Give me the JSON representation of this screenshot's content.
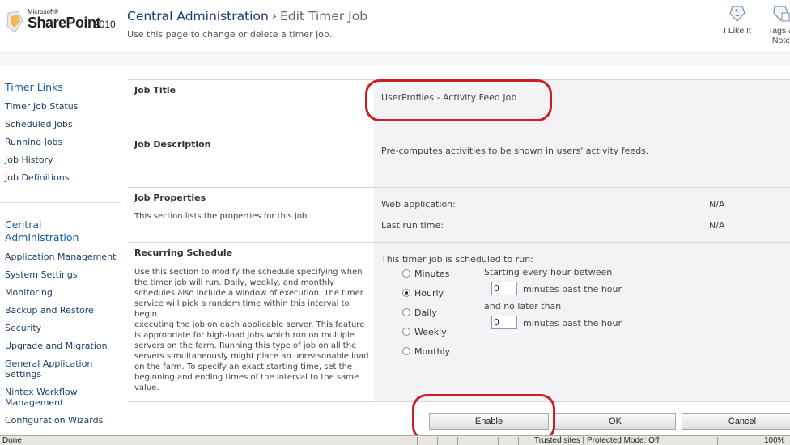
{
  "header": {
    "logo_microsoft": "Microsoft®",
    "logo_product": "SharePoint",
    "logo_year": "2010",
    "title_site": "Central Administration",
    "title_separator": "›",
    "title_page": "Edit Timer Job",
    "subtitle": "Use this page to change or delete a timer job.",
    "actions": {
      "like_label": "I Like It",
      "tags_label": "Tags &",
      "tags_label2": "Note"
    }
  },
  "leftnav": {
    "group1_title": "Timer Links",
    "group1_items": [
      "Timer Job Status",
      "Scheduled Jobs",
      "Running Jobs",
      "Job History",
      "Job Definitions"
    ],
    "group2_title_line1": "Central",
    "group2_title_line2": "Administration",
    "group2_items": [
      "Application Management",
      "System Settings",
      "Monitoring",
      "Backup and Restore",
      "Security",
      "Upgrade and Migration"
    ],
    "general_app_line1": "General Application",
    "general_app_line2": "Settings",
    "nintex_line1": "Nintex Workflow",
    "nintex_line2": "Management",
    "config_wizards": "Configuration Wizards"
  },
  "form": {
    "job_title": {
      "label": "Job Title",
      "value": "UserProfiles - Activity Feed Job"
    },
    "job_description": {
      "label": "Job Description",
      "value": "Pre-computes activities to be shown in users' activity feeds."
    },
    "job_properties": {
      "label": "Job Properties",
      "description": "This section lists the properties for this job.",
      "web_application_label": "Web application:",
      "web_application_value": "N/A",
      "last_run_label": "Last run time:",
      "last_run_value": "N/A"
    },
    "recurring_schedule": {
      "label": "Recurring Schedule",
      "description_lines": [
        "Use this section to modify the schedule specifying when",
        "the timer job will run. Daily, weekly, and monthly",
        "schedules also include a window of execution. The timer",
        "service will pick a random time within this interval to begin",
        "executing the job on each applicable server. This feature",
        "is appropriate for high-load jobs which run on multiple",
        "servers on the farm. Running this type of job on all the",
        "servers simultaneously might place an unreasonable load",
        "on the farm. To specify an exact starting time, set the",
        "beginning and ending times of the interval to the same",
        "value."
      ],
      "scheduled_to_run": "This timer job is scheduled to run:",
      "options": [
        "Minutes",
        "Hourly",
        "Daily",
        "Weekly",
        "Monthly"
      ],
      "selected": "Hourly",
      "starting_label": "Starting every hour between",
      "start_minutes": "0",
      "minutes_past_1": "minutes past the hour",
      "no_later_label": "and no later than",
      "end_minutes": "0",
      "minutes_past_2": "minutes past the hour"
    },
    "buttons": {
      "enable": "Enable",
      "ok": "OK",
      "cancel": "Cancel"
    }
  },
  "statusbar": {
    "left": "Done",
    "zone": "Trusted sites | Protected Mode: Off",
    "zoom": "100%"
  },
  "colors": {
    "highlight": "#cc1d23",
    "nav_heading": "#1a5aa0",
    "title": "#1a3a6b",
    "value_panel": "#f3f2f4"
  }
}
